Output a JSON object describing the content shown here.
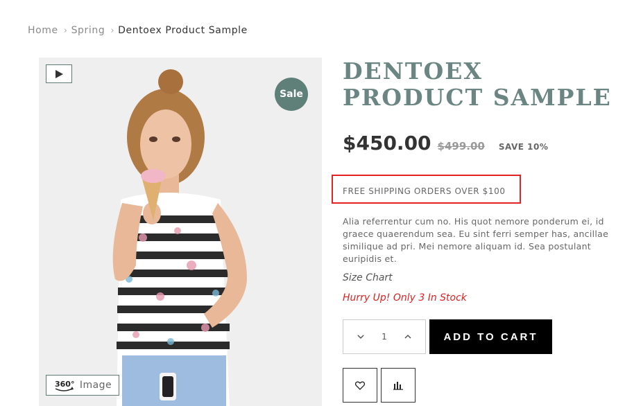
{
  "breadcrumb": {
    "items": [
      "Home",
      "Spring",
      "Dentoex Product Sample"
    ]
  },
  "gallery": {
    "sale_badge": "Sale",
    "view360_label": "Image",
    "icons": {
      "video": "play-icon",
      "view360": "360-view-icon"
    }
  },
  "product": {
    "title": "DENTOEX PRODUCT SAMPLE",
    "price": "$450.00",
    "old_price": "$499.00",
    "save": "SAVE 10%",
    "shipping": "FREE SHIPPING ORDERS OVER $100",
    "description": "Alia referrentur cum no. His quot nemore ponderum ei, id graece quaerendum sea. Eu sint ferri semper has, ancillae similique ad pri. Mei nemore aliquam id. Sea postulant euripidis et.",
    "size_chart": "Size Chart",
    "stock_note": "Hurry Up! Only 3 In Stock"
  },
  "cart": {
    "quantity": "1",
    "add_label": "ADD TO CART",
    "icons": {
      "decrease": "chevron-down-icon",
      "increase": "chevron-up-icon",
      "wishlist": "heart-icon",
      "compare": "bar-chart-icon"
    }
  },
  "colors": {
    "accent": "#6b8682",
    "sale_badge": "#5f7f79",
    "stock_warning": "#e02020",
    "highlight_box": "#e32222"
  }
}
